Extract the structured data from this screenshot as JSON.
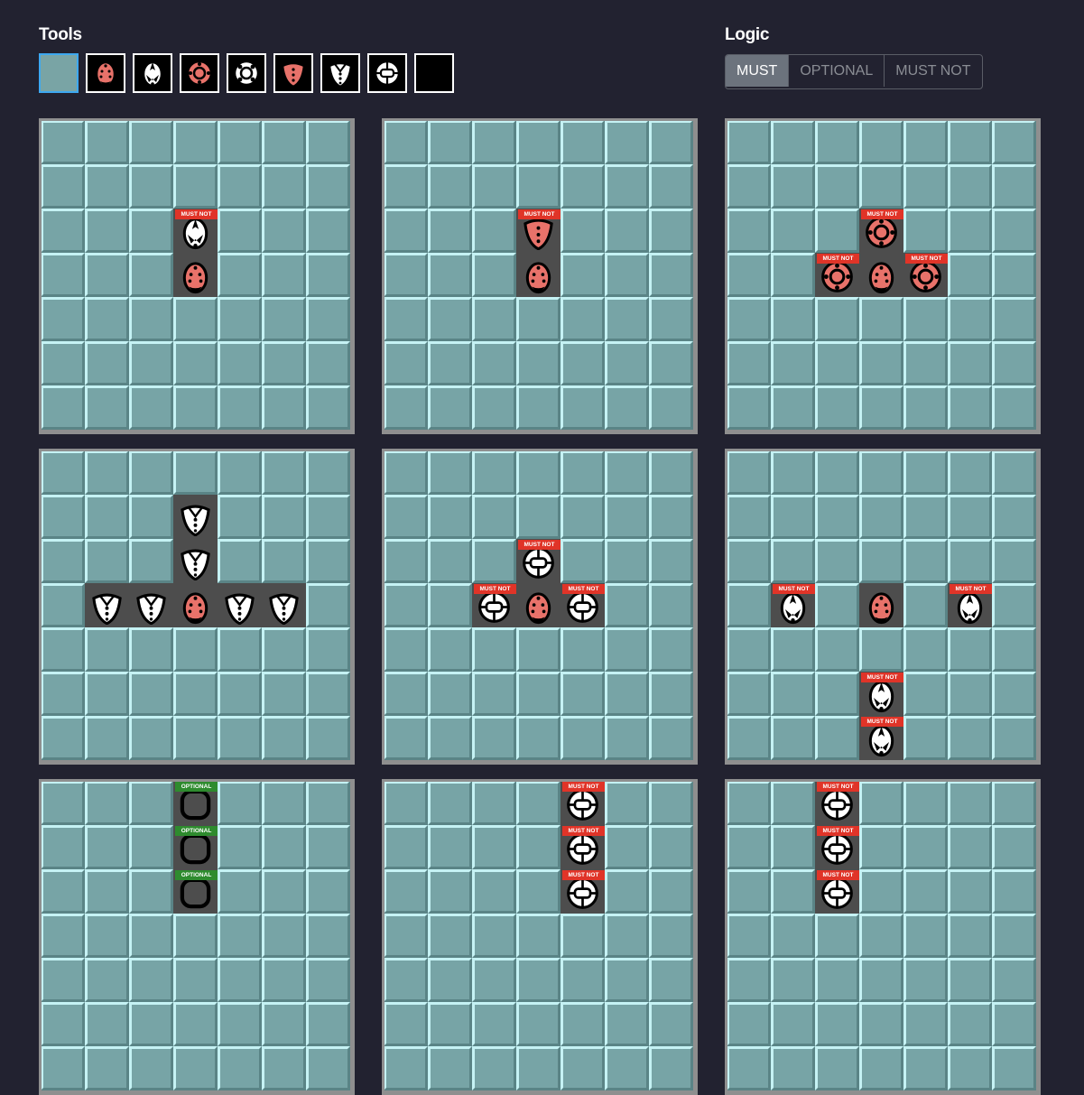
{
  "tools": {
    "title": "Tools",
    "items": [
      {
        "icon": "empty-cell-icon",
        "selected": true
      },
      {
        "icon": "red-ladybug-icon"
      },
      {
        "icon": "white-arrow-beetle-icon"
      },
      {
        "icon": "red-ring-beetle-icon"
      },
      {
        "icon": "white-ring-beetle-icon"
      },
      {
        "icon": "red-spotted-beetle-icon"
      },
      {
        "icon": "white-spotted-beetle-icon"
      },
      {
        "icon": "white-shell-beetle-icon"
      },
      {
        "icon": "rounded-square-icon"
      }
    ]
  },
  "logic": {
    "title": "Logic",
    "options": [
      "MUST",
      "OPTIONAL",
      "MUST NOT"
    ],
    "selected": "MUST"
  },
  "colors": {
    "background": "#222230",
    "cell": "#77a4a6",
    "filled_cell": "#4d4d4d",
    "must_not": "#e03428",
    "optional": "#2e8b2e",
    "selected_tool_border": "#3da8f0",
    "red_beetle": "#e8726a"
  },
  "grids": [
    {
      "cells": [
        {
          "r": 2,
          "c": 3,
          "icon": "white-arrow-beetle-icon",
          "logic": "MUST NOT"
        },
        {
          "r": 3,
          "c": 3,
          "icon": "red-ladybug-icon"
        }
      ]
    },
    {
      "cells": [
        {
          "r": 2,
          "c": 3,
          "icon": "red-spotted-beetle-icon",
          "logic": "MUST NOT"
        },
        {
          "r": 3,
          "c": 3,
          "icon": "red-ladybug-icon"
        }
      ]
    },
    {
      "cells": [
        {
          "r": 2,
          "c": 3,
          "icon": "red-ring-beetle-icon",
          "logic": "MUST NOT"
        },
        {
          "r": 3,
          "c": 2,
          "icon": "red-ring-beetle-icon",
          "logic": "MUST NOT"
        },
        {
          "r": 3,
          "c": 3,
          "icon": "red-ladybug-icon"
        },
        {
          "r": 3,
          "c": 4,
          "icon": "red-ring-beetle-icon",
          "logic": "MUST NOT"
        }
      ]
    },
    {
      "cells": [
        {
          "r": 1,
          "c": 3,
          "icon": "white-spotted-beetle-icon"
        },
        {
          "r": 2,
          "c": 3,
          "icon": "white-spotted-beetle-icon"
        },
        {
          "r": 3,
          "c": 1,
          "icon": "white-spotted-beetle-icon"
        },
        {
          "r": 3,
          "c": 2,
          "icon": "white-spotted-beetle-icon"
        },
        {
          "r": 3,
          "c": 3,
          "icon": "red-ladybug-icon"
        },
        {
          "r": 3,
          "c": 4,
          "icon": "white-spotted-beetle-icon"
        },
        {
          "r": 3,
          "c": 5,
          "icon": "white-spotted-beetle-icon"
        }
      ]
    },
    {
      "cells": [
        {
          "r": 2,
          "c": 3,
          "icon": "white-shell-beetle-icon",
          "logic": "MUST NOT"
        },
        {
          "r": 3,
          "c": 2,
          "icon": "white-shell-beetle-icon",
          "logic": "MUST NOT"
        },
        {
          "r": 3,
          "c": 3,
          "icon": "red-ladybug-icon"
        },
        {
          "r": 3,
          "c": 4,
          "icon": "white-shell-beetle-icon",
          "logic": "MUST NOT"
        }
      ]
    },
    {
      "cells": [
        {
          "r": 3,
          "c": 1,
          "icon": "white-arrow-beetle-icon",
          "logic": "MUST NOT"
        },
        {
          "r": 3,
          "c": 3,
          "icon": "red-ladybug-icon"
        },
        {
          "r": 3,
          "c": 5,
          "icon": "white-arrow-beetle-icon",
          "logic": "MUST NOT"
        },
        {
          "r": 5,
          "c": 3,
          "icon": "white-arrow-beetle-icon",
          "logic": "MUST NOT"
        },
        {
          "r": 6,
          "c": 3,
          "icon": "white-arrow-beetle-icon",
          "logic": "MUST NOT"
        }
      ]
    },
    {
      "cells": [
        {
          "r": 0,
          "c": 3,
          "icon": "rounded-square-icon",
          "logic": "OPTIONAL"
        },
        {
          "r": 1,
          "c": 3,
          "icon": "rounded-square-icon",
          "logic": "OPTIONAL"
        },
        {
          "r": 2,
          "c": 3,
          "icon": "rounded-square-icon",
          "logic": "OPTIONAL"
        }
      ]
    },
    {
      "cells": [
        {
          "r": 0,
          "c": 4,
          "icon": "white-shell-beetle-icon",
          "logic": "MUST NOT"
        },
        {
          "r": 1,
          "c": 4,
          "icon": "white-shell-beetle-icon",
          "logic": "MUST NOT"
        },
        {
          "r": 2,
          "c": 4,
          "icon": "white-shell-beetle-icon",
          "logic": "MUST NOT"
        }
      ]
    },
    {
      "cells": [
        {
          "r": 0,
          "c": 2,
          "icon": "white-shell-beetle-icon",
          "logic": "MUST NOT"
        },
        {
          "r": 1,
          "c": 2,
          "icon": "white-shell-beetle-icon",
          "logic": "MUST NOT"
        },
        {
          "r": 2,
          "c": 2,
          "icon": "white-shell-beetle-icon",
          "logic": "MUST NOT"
        }
      ]
    }
  ]
}
